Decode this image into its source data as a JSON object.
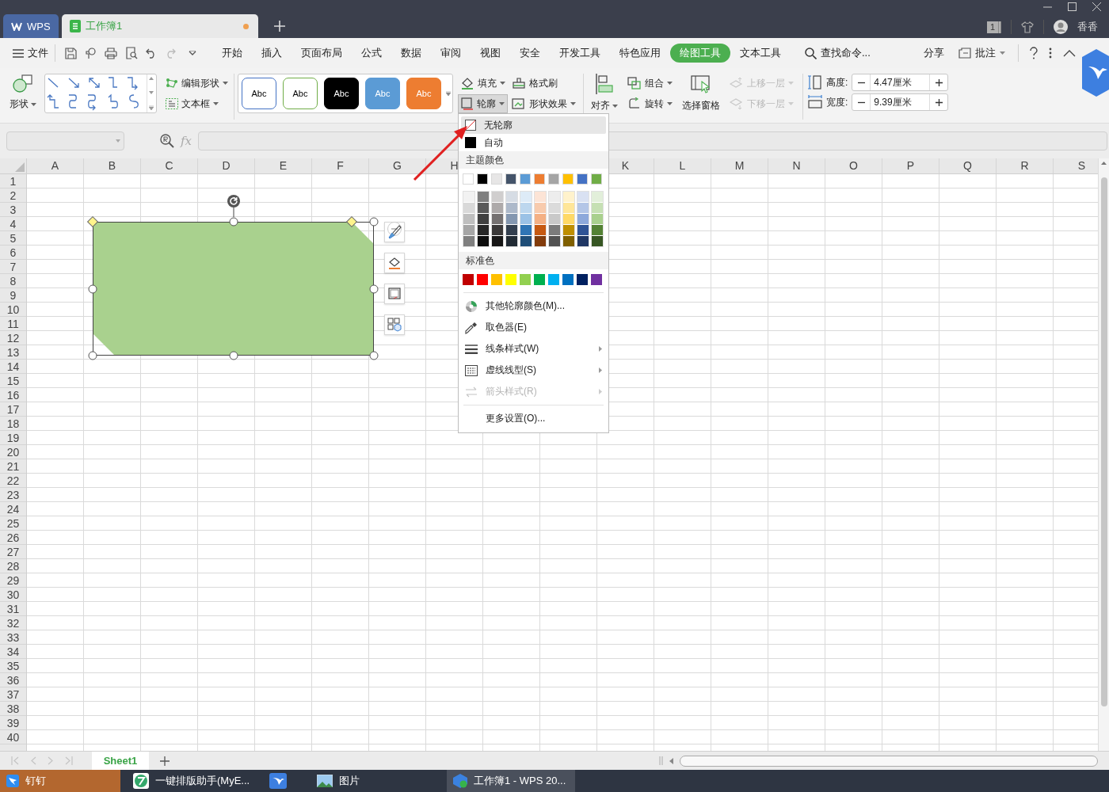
{
  "title_bar": {
    "tabs": [
      {
        "label": "WPS",
        "kind": "app",
        "selected": false,
        "unsaved": false
      },
      {
        "label": "工作簿1",
        "kind": "sheet",
        "selected": true,
        "unsaved": true
      }
    ],
    "window_count": "1",
    "user": "香香"
  },
  "menu_bar": {
    "file_menu": "文件",
    "tabs": [
      {
        "label": "开始",
        "selected": false
      },
      {
        "label": "插入",
        "selected": false
      },
      {
        "label": "页面布局",
        "selected": false
      },
      {
        "label": "公式",
        "selected": false
      },
      {
        "label": "数据",
        "selected": false
      },
      {
        "label": "审阅",
        "selected": false
      },
      {
        "label": "视图",
        "selected": false
      },
      {
        "label": "安全",
        "selected": false
      },
      {
        "label": "开发工具",
        "selected": false
      },
      {
        "label": "特色应用",
        "selected": false
      },
      {
        "label": "绘图工具",
        "selected": true
      },
      {
        "label": "文本工具",
        "selected": false
      }
    ],
    "search": "查找命令...",
    "share": "分享",
    "comment": "批注"
  },
  "ribbon": {
    "shape": "形状",
    "edit_shape": "编辑形状",
    "text_box": "文本框",
    "styles": [
      {
        "label": "Abc",
        "kind": "outline",
        "color": "#4472c4"
      },
      {
        "label": "Abc",
        "kind": "outline",
        "color": "#70ad47"
      },
      {
        "label": "Abc",
        "kind": "filled",
        "color": "#000000"
      },
      {
        "label": "Abc",
        "kind": "filled",
        "color": "#5b9bd5"
      },
      {
        "label": "Abc",
        "kind": "filled",
        "color": "#ed7d31"
      }
    ],
    "format_buttons": [
      {
        "label": "填充",
        "kind": "fill",
        "dropdown": true,
        "pressed": false
      },
      {
        "label": "格式刷",
        "kind": "brush",
        "dropdown": false,
        "pressed": false
      },
      {
        "label": "轮廓",
        "kind": "outline",
        "dropdown": true,
        "pressed": true
      },
      {
        "label": "形状效果",
        "kind": "effects",
        "dropdown": true,
        "pressed": false
      }
    ],
    "arrange_groups": [
      [
        {
          "label": "对齐",
          "kind": "align",
          "dropdown": true,
          "disabled": false
        }
      ],
      [
        {
          "label": "组合",
          "kind": "group",
          "dropdown": true,
          "disabled": false
        },
        {
          "label": "旋转",
          "kind": "rotate",
          "dropdown": true,
          "disabled": false
        }
      ],
      [
        {
          "label": "选择窗格",
          "kind": "pane",
          "dropdown": false,
          "disabled": false
        }
      ],
      [
        {
          "label": "上移一层",
          "kind": "forward",
          "dropdown": true,
          "disabled": true
        },
        {
          "label": "下移一层",
          "kind": "backward",
          "dropdown": true,
          "disabled": true
        }
      ]
    ],
    "size": [
      {
        "label": "高度:",
        "value": "4.47厘米",
        "kind": "height"
      },
      {
        "label": "宽度:",
        "value": "9.39厘米",
        "kind": "width"
      }
    ]
  },
  "formula_bar": {
    "function_label": "fx"
  },
  "sheet": {
    "columns": [
      {
        "label": "A"
      },
      {
        "label": "B"
      },
      {
        "label": "C"
      },
      {
        "label": "D"
      },
      {
        "label": "E"
      },
      {
        "label": "F"
      },
      {
        "label": "G"
      },
      {
        "label": "H"
      },
      {},
      {},
      {
        "label": "K"
      },
      {
        "label": "L"
      },
      {
        "label": "M"
      },
      {
        "label": "N"
      },
      {
        "label": "O"
      },
      {
        "label": "P"
      },
      {
        "label": "Q"
      },
      {
        "label": "R"
      },
      {
        "label": "S"
      }
    ],
    "rows": [
      "1",
      "2",
      "3",
      "4",
      "5",
      "6",
      "7",
      "8",
      "9",
      "10",
      "11",
      "12",
      "13",
      "14",
      "15",
      "16",
      "17",
      "18",
      "19",
      "20",
      "21",
      "22",
      "23",
      "24",
      "25",
      "26",
      "27",
      "28",
      "29",
      "30",
      "31",
      "32",
      "33",
      "34",
      "35",
      "36",
      "37",
      "38",
      "39",
      "40"
    ]
  },
  "shape": {
    "selected": true
  },
  "outline_menu": {
    "options": [
      {
        "label": "无轮廓",
        "kind": "none",
        "selected": true
      },
      {
        "label": "自动",
        "kind": "auto",
        "selected": false
      }
    ],
    "theme_title": "主题颜色",
    "theme_colors": [
      {
        "color": "#ffffff",
        "shades": [
          {
            "color": "#f2f2f2"
          },
          {
            "color": "#d9d9d9"
          },
          {
            "color": "#bfbfbf"
          },
          {
            "color": "#a6a6a6"
          },
          {
            "color": "#808080"
          }
        ]
      },
      {
        "color": "#000000",
        "shades": [
          {
            "color": "#7f7f7f"
          },
          {
            "color": "#595959"
          },
          {
            "color": "#404040"
          },
          {
            "color": "#262626"
          },
          {
            "color": "#0d0d0d"
          }
        ]
      },
      {
        "color": "#e7e6e6",
        "shades": [
          {
            "color": "#d0cece"
          },
          {
            "color": "#aeaaaa"
          },
          {
            "color": "#757171"
          },
          {
            "color": "#3a3838"
          },
          {
            "color": "#171616"
          }
        ]
      },
      {
        "color": "#44546a",
        "shades": [
          {
            "color": "#d6dce4"
          },
          {
            "color": "#adb9ca"
          },
          {
            "color": "#8497b0"
          },
          {
            "color": "#333f4f"
          },
          {
            "color": "#222b35"
          }
        ]
      },
      {
        "color": "#5b9bd5",
        "shades": [
          {
            "color": "#ddebf7"
          },
          {
            "color": "#bdd7ee"
          },
          {
            "color": "#9bc2e6"
          },
          {
            "color": "#2f75b5"
          },
          {
            "color": "#1f4e78"
          }
        ]
      },
      {
        "color": "#ed7d31",
        "shades": [
          {
            "color": "#fce4d6"
          },
          {
            "color": "#f8cbad"
          },
          {
            "color": "#f4b084"
          },
          {
            "color": "#c65911"
          },
          {
            "color": "#833c0c"
          }
        ]
      },
      {
        "color": "#a5a5a5",
        "shades": [
          {
            "color": "#ededed"
          },
          {
            "color": "#dbdbdb"
          },
          {
            "color": "#c9c9c9"
          },
          {
            "color": "#7b7b7b"
          },
          {
            "color": "#525252"
          }
        ]
      },
      {
        "color": "#ffc000",
        "shades": [
          {
            "color": "#fff2cc"
          },
          {
            "color": "#ffe699"
          },
          {
            "color": "#ffd966"
          },
          {
            "color": "#bf8f00"
          },
          {
            "color": "#806000"
          }
        ]
      },
      {
        "color": "#4472c4",
        "shades": [
          {
            "color": "#d9e1f2"
          },
          {
            "color": "#b4c6e7"
          },
          {
            "color": "#8ea9db"
          },
          {
            "color": "#305496"
          },
          {
            "color": "#203764"
          }
        ]
      },
      {
        "color": "#70ad47",
        "shades": [
          {
            "color": "#e2efda"
          },
          {
            "color": "#c6e0b4"
          },
          {
            "color": "#a9d08e"
          },
          {
            "color": "#548235"
          },
          {
            "color": "#375623"
          }
        ]
      }
    ],
    "standard_title": "标准色",
    "standard_colors": [
      {
        "color": "#c00000"
      },
      {
        "color": "#ff0000"
      },
      {
        "color": "#ffc000"
      },
      {
        "color": "#ffff00"
      },
      {
        "color": "#92d050"
      },
      {
        "color": "#00b050"
      },
      {
        "color": "#00b0f0"
      },
      {
        "color": "#0070c0"
      },
      {
        "color": "#002060"
      },
      {
        "color": "#7030a0"
      }
    ],
    "commands": [
      {
        "label": "其他轮廓颜色(M)...",
        "kind": "colors",
        "submenu": false,
        "disabled": false
      },
      {
        "label": "取色器(E)",
        "kind": "picker",
        "submenu": false,
        "disabled": false
      },
      {
        "label": "线条样式(W)",
        "kind": "weight",
        "submenu": true,
        "disabled": false
      },
      {
        "label": "虚线线型(S)",
        "kind": "dash",
        "submenu": true,
        "disabled": false
      },
      {
        "label": "箭头样式(R)",
        "kind": "arrows",
        "submenu": true,
        "disabled": true
      }
    ],
    "more_settings": "更多设置(O)..."
  },
  "sheet_tabs": [
    {
      "label": "Sheet1",
      "selected": true
    }
  ],
  "taskbar": [
    {
      "label": "钉钉",
      "kind": "chat",
      "selected": false,
      "attention": true
    },
    {
      "label": "一键排版助手(MyE...",
      "kind": "editor",
      "selected": false,
      "attention": false
    },
    {
      "kind": "bird",
      "selected": false,
      "attention": false
    },
    {
      "label": "图片",
      "kind": "photos",
      "selected": false,
      "attention": false
    },
    {
      "label": "工作簿1 - WPS 20...",
      "kind": "wps",
      "selected": true,
      "attention": false
    }
  ]
}
